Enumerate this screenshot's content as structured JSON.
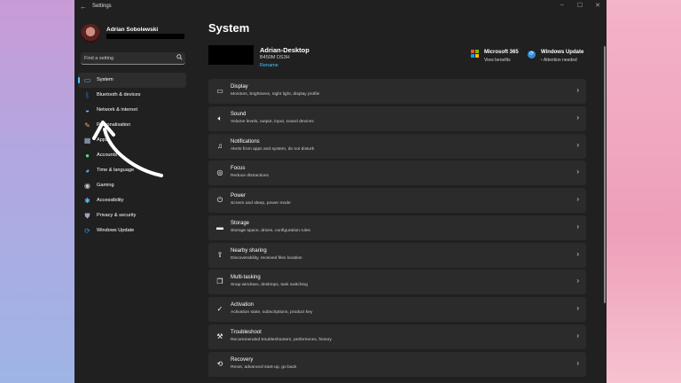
{
  "window": {
    "title": "Settings",
    "back_glyph": "←"
  },
  "window_controls": {
    "minimize": "–",
    "maximize": "☐",
    "close": "✕"
  },
  "profile": {
    "name": "Adrian Sobolewski"
  },
  "search": {
    "placeholder": "Find a setting"
  },
  "sidebar": {
    "items": [
      {
        "label": "System",
        "icon": "monitor-icon",
        "glyph": "▭",
        "color": "#4cc2ff",
        "active": true
      },
      {
        "label": "Bluetooth & devices",
        "icon": "bluetooth-icon",
        "glyph": "ᛒ",
        "color": "#3b8ee6"
      },
      {
        "label": "Network & internet",
        "icon": "wifi-icon",
        "glyph": "◒",
        "color": "#6ac3ff"
      },
      {
        "label": "Personalisation",
        "icon": "brush-icon",
        "glyph": "✎",
        "color": "#f0a35a"
      },
      {
        "label": "Apps",
        "icon": "apps-icon",
        "glyph": "▦",
        "color": "#a7b9d6"
      },
      {
        "label": "Accounts",
        "icon": "person-icon",
        "glyph": "●",
        "color": "#5fd38a"
      },
      {
        "label": "Time & language",
        "icon": "globe-clock-icon",
        "glyph": "◕",
        "color": "#4cb0ff"
      },
      {
        "label": "Gaming",
        "icon": "controller-icon",
        "glyph": "◉",
        "color": "#c9c9c9"
      },
      {
        "label": "Accessibility",
        "icon": "accessibility-icon",
        "glyph": "✱",
        "color": "#4cc2ff"
      },
      {
        "label": "Privacy & security",
        "icon": "shield-icon",
        "glyph": "⛊",
        "color": "#9aa7b6"
      },
      {
        "label": "Windows Update",
        "icon": "update-icon",
        "glyph": "⟳",
        "color": "#2f8fde"
      }
    ]
  },
  "main": {
    "title": "System",
    "device": {
      "name": "Adrian-Desktop",
      "model": "B450M DS3H",
      "rename": "Rename"
    },
    "ms365": {
      "title": "Microsoft 365",
      "subtitle": "View benefits"
    },
    "windows_update": {
      "title": "Windows Update",
      "subtitle": "Attention needed"
    },
    "cards": [
      {
        "title": "Display",
        "subtitle": "Monitors, brightness, night light, display profile",
        "icon": "display-icon",
        "glyph": "▭"
      },
      {
        "title": "Sound",
        "subtitle": "Volume levels, output, input, sound devices",
        "icon": "speaker-icon",
        "glyph": "🔈︎"
      },
      {
        "title": "Notifications",
        "subtitle": "Alerts from apps and system, do not disturb",
        "icon": "bell-icon",
        "glyph": "♫"
      },
      {
        "title": "Focus",
        "subtitle": "Reduce distractions",
        "icon": "focus-icon",
        "glyph": "◎"
      },
      {
        "title": "Power",
        "subtitle": "Screen and sleep, power mode",
        "icon": "power-icon",
        "glyph": "⏻"
      },
      {
        "title": "Storage",
        "subtitle": "Storage space, drives, configuration rules",
        "icon": "storage-icon",
        "glyph": "▬"
      },
      {
        "title": "Nearby sharing",
        "subtitle": "Discoverability, received files location",
        "icon": "share-icon",
        "glyph": "⇪"
      },
      {
        "title": "Multi-tasking",
        "subtitle": "Snap windows, desktops, task switching",
        "icon": "multitask-icon",
        "glyph": "❐"
      },
      {
        "title": "Activation",
        "subtitle": "Activation state, subscriptions, product key",
        "icon": "check-circle-icon",
        "glyph": "✓"
      },
      {
        "title": "Troubleshoot",
        "subtitle": "Recommended troubleshooters, preferences, history",
        "icon": "wrench-icon",
        "glyph": "⚒"
      },
      {
        "title": "Recovery",
        "subtitle": "Reset, advanced start-up, go back",
        "icon": "recovery-icon",
        "glyph": "⟲"
      }
    ],
    "chevron": "›"
  }
}
